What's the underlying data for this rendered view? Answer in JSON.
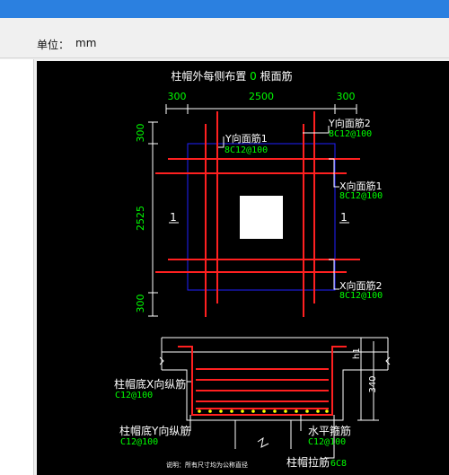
{
  "window": {
    "title_bar_color": "#2b80e0"
  },
  "toolbar": {
    "unit_label": "单位：",
    "unit_value": "mm"
  },
  "drawing": {
    "title_prefix": "柱帽外每侧布置",
    "title_count": "0",
    "title_suffix": "根面筋",
    "top_dims": [
      "300",
      "2500",
      "300"
    ],
    "left_dims": [
      "300",
      "2525",
      "300"
    ],
    "section_mark_left": "1",
    "section_mark_right": "1",
    "y_top_bar1_label": "Y向面筋1",
    "y_top_bar1_spec": "8C12@100",
    "y_top_bar2_label": "Y向面筋2",
    "y_top_bar2_spec": "8C12@100",
    "x_top_bar1_label": "X向面筋1",
    "x_top_bar1_spec": "8C12@100",
    "x_top_bar2_label": "X向面筋2",
    "x_top_bar2_spec": "8C12@100",
    "section": {
      "h1_label": "h1",
      "height_dim": "340",
      "bottom_x_label": "柱帽底X向纵筋",
      "bottom_x_spec": "C12@100",
      "bottom_y_label": "柱帽底Y向纵筋",
      "bottom_y_spec": "C12@100",
      "stirrup_label": "水平箍筋",
      "stirrup_spec": "C12@100",
      "tie_label": "柱帽拉筋",
      "tie_spec": "6C8",
      "note": "说明：所有尺寸均为公称直径"
    },
    "colors": {
      "rebar": "#ff2020",
      "dim": "#ffffff",
      "outline": "#2020ff",
      "spec": "#00ff00",
      "dot": "#ffff00"
    }
  }
}
